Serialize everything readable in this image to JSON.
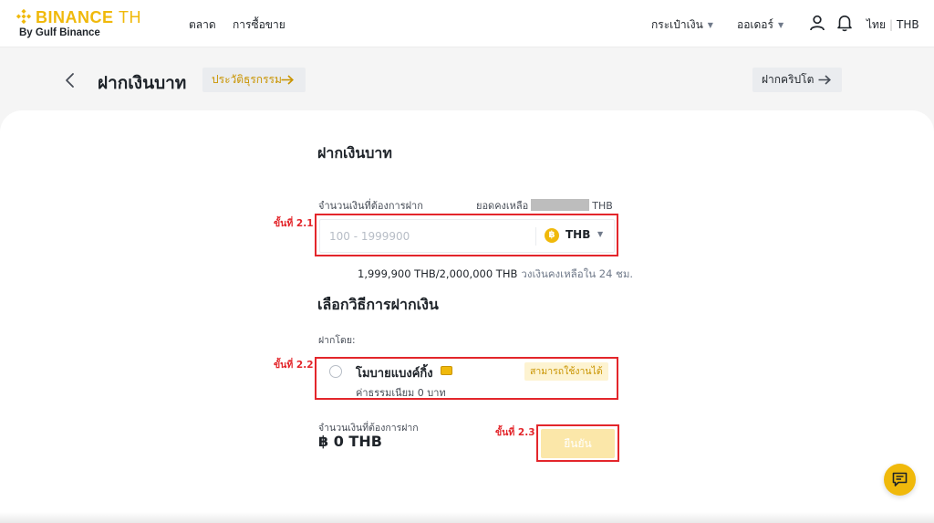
{
  "brand": {
    "name": "BINANCE",
    "suffix": "TH",
    "subtitle": "By Gulf Binance",
    "color": "#f0b90b"
  },
  "nav": {
    "left": [
      {
        "label": "ตลาด"
      },
      {
        "label": "การซื้อขาย"
      }
    ],
    "wallet_label": "กระเป๋าเงิน",
    "orders_label": "ออเดอร์",
    "icons": [
      "user-icon",
      "bell-icon"
    ],
    "language": "ไทย",
    "currency": "THB"
  },
  "header": {
    "title": "ฝากเงินบาท",
    "history_label": "ประวัติธุรกรรม",
    "crypto_deposit_label": "ฝากคริปโต"
  },
  "deposit": {
    "section_title": "ฝากเงินบาท",
    "amount_label": "จำนวนเงินที่ต้องการฝาก",
    "balance_label": "ยอดคงเหลือ",
    "balance_currency": "THB",
    "amount_placeholder": "100 - 1999900",
    "amount_value": "",
    "currency": "THB",
    "currency_symbol": "฿",
    "limit_used": "1,999,900 THB/2,000,000 THB",
    "limit_note": "วงเงินคงเหลือใน 24 ชม."
  },
  "method": {
    "section_title": "เลือกวิธีการฝากเงิน",
    "by_label": "ฝากโดย:",
    "name": "โมบายแบงค์กิ้ง",
    "fee": "ค่าธรรมเนียม 0 บาท",
    "badge": "สามารถใช้งานได้",
    "selected": false
  },
  "summary": {
    "total_label": "จำนวนเงินที่ต้องการฝาก",
    "total_value": "฿ 0 THB",
    "confirm_label": "ยืนยัน"
  },
  "annotations": [
    {
      "label": "ขั้นที่ 2.1"
    },
    {
      "label": "ขั้นที่ 2.2"
    },
    {
      "label": "ขั้นที่ 2.3"
    }
  ],
  "colors": {
    "accent": "#f0b90b",
    "annotation": "#e3262b",
    "confirm_disabled": "#fbe7a9"
  }
}
